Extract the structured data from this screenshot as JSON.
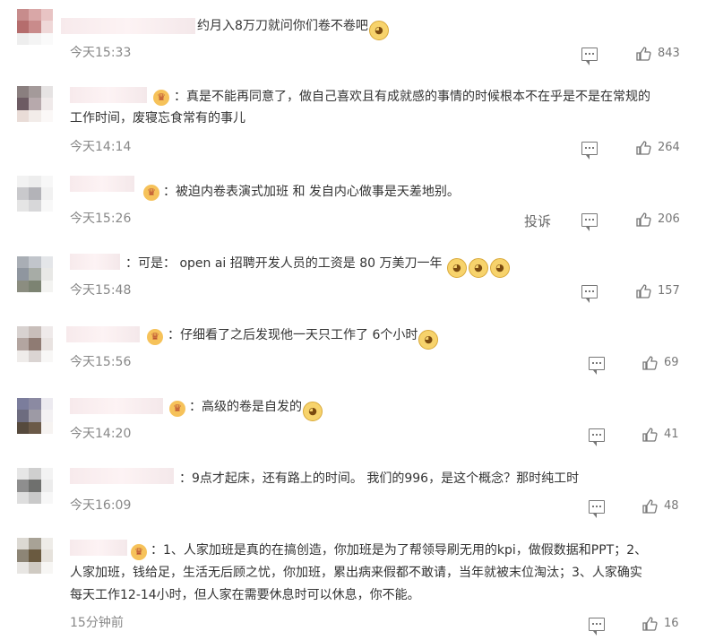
{
  "comments": [
    {
      "text_lines": [
        "约月入8万刀就问你们卷不卷吧"
      ],
      "time": "今天15:33",
      "likes": "843",
      "has_vip": false
    },
    {
      "text_lines": [
        "：真是不能再同意了，做自己喜欢且有成就感的事情的时候根本不在乎是不是在常规的",
        "工作时间，废寝忘食常有的事儿"
      ],
      "time": "今天14:14",
      "likes": "264",
      "has_vip": true
    },
    {
      "text_lines": [
        "：被迫内卷表演式加班 和 发自内心做事是天差地别。"
      ],
      "time": "今天15:26",
      "likes": "206",
      "has_vip": true,
      "report_label": "投诉"
    },
    {
      "text_lines": [
        "：可是： open ai 招聘开发人员的工资是 80 万美刀一年"
      ],
      "time": "今天15:48",
      "likes": "157",
      "has_vip": false
    },
    {
      "text_lines": [
        "：仔细看了之后发现他一天只工作了 6个小时"
      ],
      "time": "今天15:56",
      "likes": "69",
      "has_vip": true
    },
    {
      "text_lines": [
        "：高级的卷是自发的"
      ],
      "time": "今天14:20",
      "likes": "41",
      "has_vip": true
    },
    {
      "text_lines": [
        "：9点才起床，还有路上的时间。 我们的996，是这个概念？那时纯工时"
      ],
      "time": "今天16:09",
      "likes": "48",
      "has_vip": false
    },
    {
      "text_lines": [
        "：1、人家加班是真的在搞创造，你加班是为了帮领导刷无用的kpi，做假数据和PPT；2、",
        "人家加班，钱给足，生活无后顾之忧，你加班，累出病来假都不敢请，当年就被末位淘汰；3、人家确实",
        "每天工作12-14小时，但人家在需要休息时可以休息，你不能。"
      ],
      "time": "15分钟前",
      "likes": "16",
      "has_vip": true
    }
  ],
  "icons": {
    "reply": "comment-icon",
    "like": "thumbs-up-icon",
    "badge": "vip-crown-icon",
    "emoji": "doge-emoji"
  }
}
